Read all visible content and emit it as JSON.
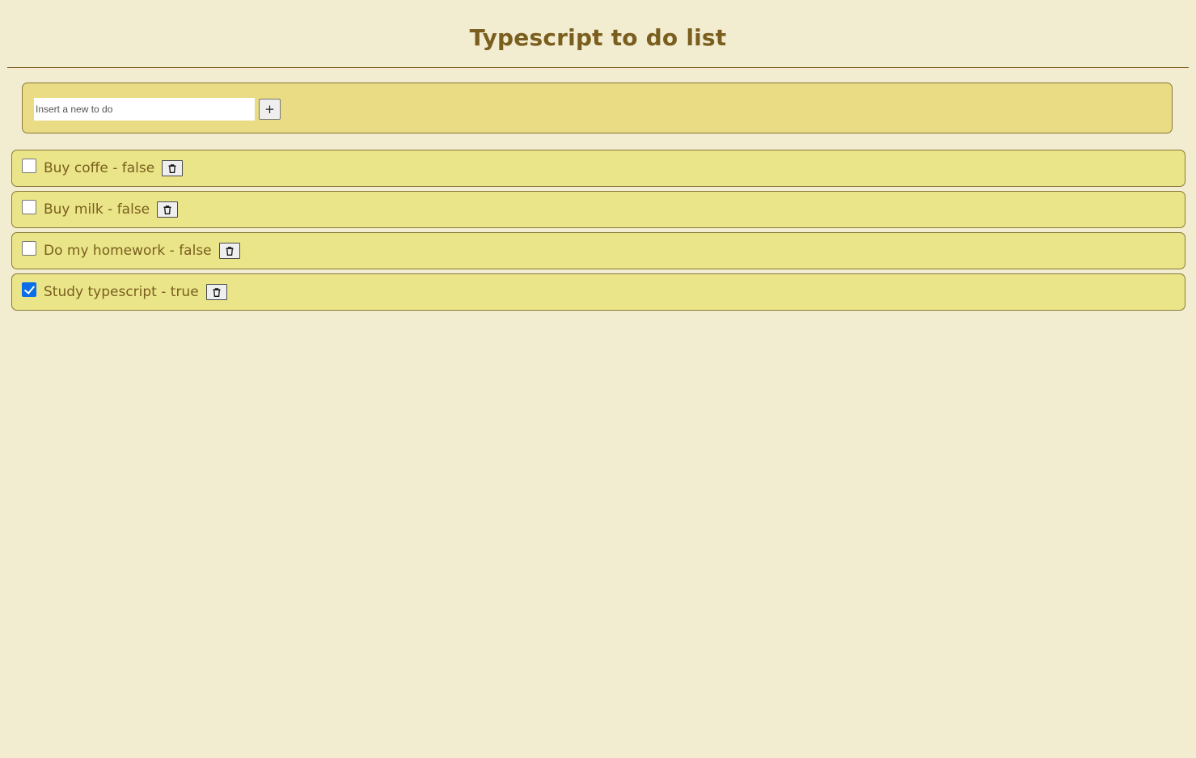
{
  "header": {
    "title": "Typescript to do list"
  },
  "add_form": {
    "input_placeholder": "Insert a new to do",
    "input_value": "",
    "add_button_label": "+"
  },
  "todos": [
    {
      "label": "Buy coffe - false",
      "done": false,
      "delete_icon": "trash-icon"
    },
    {
      "label": "Buy milk - false",
      "done": false,
      "delete_icon": "trash-icon"
    },
    {
      "label": "Do my homework - false",
      "done": false,
      "delete_icon": "trash-icon"
    },
    {
      "label": "Study typescript - true",
      "done": true,
      "delete_icon": "trash-icon"
    }
  ],
  "colors": {
    "background": "#f2ecd0",
    "text": "#7a5e1e",
    "panel": "#eadb85",
    "item": "#eae589",
    "checkbox_checked": "#0b6ee6"
  }
}
